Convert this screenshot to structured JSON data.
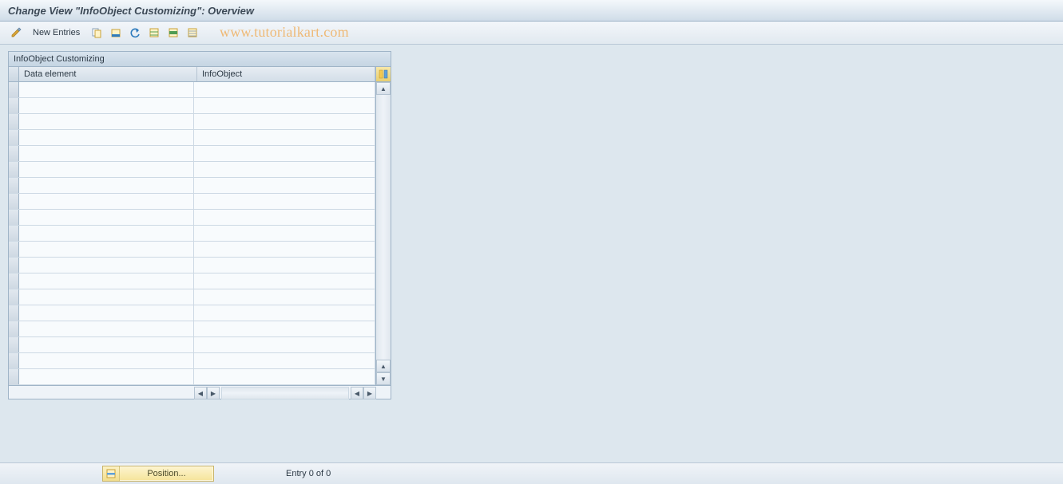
{
  "title": "Change View \"InfoObject Customizing\": Overview",
  "toolbar": {
    "new_entries_label": "New Entries"
  },
  "watermark": "www.tutorialkart.com",
  "panel": {
    "title": "InfoObject Customizing",
    "columns": {
      "data_element": "Data element",
      "infoobject": "InfoObject"
    },
    "rows": [
      {
        "data_element": "",
        "infoobject": ""
      },
      {
        "data_element": "",
        "infoobject": ""
      },
      {
        "data_element": "",
        "infoobject": ""
      },
      {
        "data_element": "",
        "infoobject": ""
      },
      {
        "data_element": "",
        "infoobject": ""
      },
      {
        "data_element": "",
        "infoobject": ""
      },
      {
        "data_element": "",
        "infoobject": ""
      },
      {
        "data_element": "",
        "infoobject": ""
      },
      {
        "data_element": "",
        "infoobject": ""
      },
      {
        "data_element": "",
        "infoobject": ""
      },
      {
        "data_element": "",
        "infoobject": ""
      },
      {
        "data_element": "",
        "infoobject": ""
      },
      {
        "data_element": "",
        "infoobject": ""
      },
      {
        "data_element": "",
        "infoobject": ""
      },
      {
        "data_element": "",
        "infoobject": ""
      },
      {
        "data_element": "",
        "infoobject": ""
      },
      {
        "data_element": "",
        "infoobject": ""
      },
      {
        "data_element": "",
        "infoobject": ""
      },
      {
        "data_element": "",
        "infoobject": ""
      },
      {
        "data_element": "",
        "infoobject": ""
      }
    ]
  },
  "footer": {
    "position_label": "Position...",
    "entry_text": "Entry 0 of 0"
  }
}
